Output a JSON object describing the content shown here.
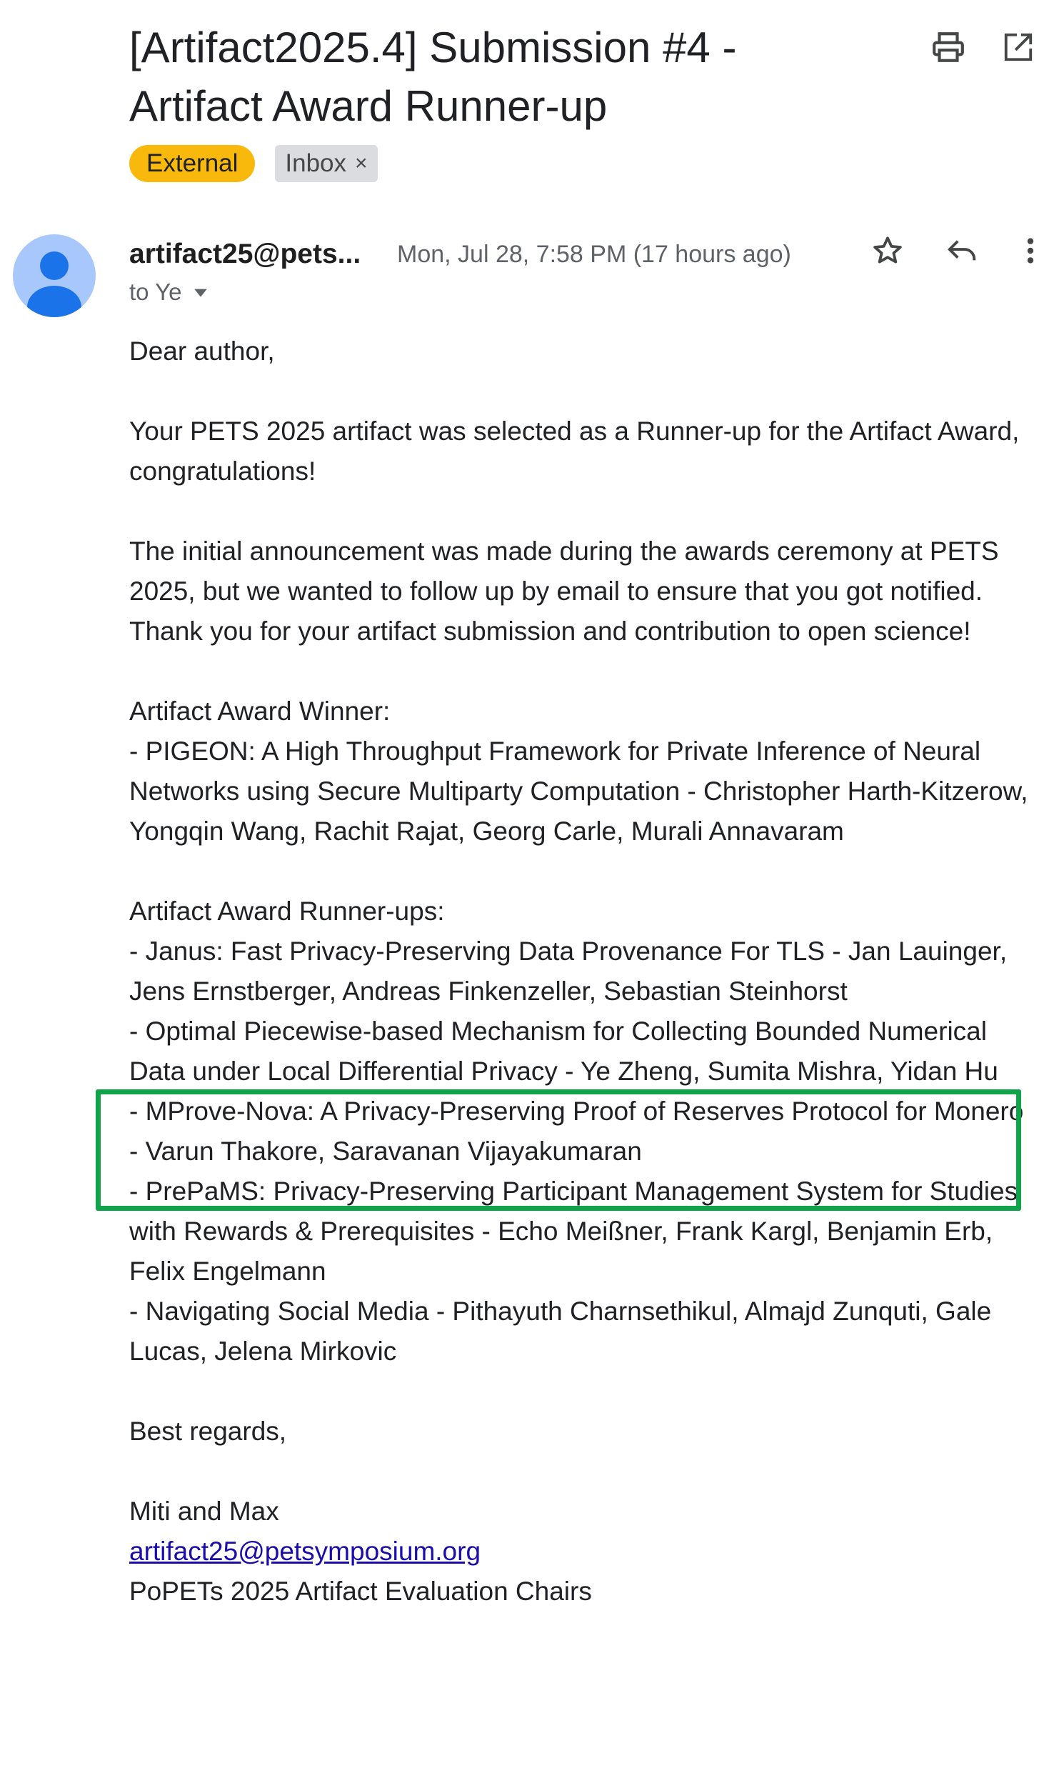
{
  "email": {
    "subject": "[Artifact2025.4] Submission #4 - Artifact Award Runner-up",
    "labels": {
      "external": "External",
      "inbox": "Inbox",
      "inbox_remove": "×"
    },
    "sender": "artifact25@pets...",
    "date": "Mon, Jul 28, 7:58 PM (17 hours ago)",
    "to": "to Ye",
    "body": {
      "greeting": "Dear author,",
      "para1": "Your PETS 2025 artifact was selected as a Runner-up for the Artifact Award, congratulations!",
      "para2a": "The initial announcement was made during the awards ceremony at PETS 2025, but we wanted to follow up by email to ensure that you got notified.",
      "para2b": "Thank you for your artifact submission and contribution to open science!",
      "winner_heading": "Artifact Award Winner:",
      "winner": "- PIGEON: A High Throughput Framework for Private Inference of Neural Networks using Secure Multiparty Computation - Christopher Harth-Kitzerow, Yongqin Wang, Rachit Rajat, Georg Carle, Murali Annavaram",
      "runnerups_heading": "Artifact Award Runner-ups:",
      "runnerups": [
        "- Janus: Fast Privacy-Preserving Data Provenance For TLS - Jan Lauinger, Jens Ernstberger, Andreas Finkenzeller, Sebastian Steinhorst",
        "- Optimal Piecewise-based Mechanism for Collecting Bounded Numerical Data under Local Differential Privacy - Ye Zheng, Sumita Mishra, Yidan Hu",
        "- MProve-Nova: A Privacy-Preserving Proof of Reserves Protocol for Monero - Varun Thakore, Saravanan Vijayakumaran",
        "- PrePaMS: Privacy-Preserving Participant Management System for Studies with Rewards & Prerequisites - Echo Meißner, Frank Kargl, Benjamin Erb, Felix Engelmann",
        "- Navigating Social Media - Pithayuth Charnsethikul, Almajd Zunquti, Gale Lucas, Jelena Mirkovic"
      ],
      "closing": "Best regards,",
      "signature_name": "Miti and Max",
      "signature_email": "artifact25@petsymposium.org",
      "signature_title": "PoPETs 2025 Artifact Evaluation Chairs"
    }
  },
  "icons": [
    "print-icon",
    "open-in-new-window-icon",
    "avatar-person-icon",
    "star-icon",
    "reply-icon",
    "more-vert-icon",
    "dropdown-arrow-icon"
  ],
  "colors": {
    "external_chip": "#f9b90c",
    "inbox_chip": "#dadce0",
    "avatar_bg": "#a8c7fa",
    "avatar_fg": "#1a73e8",
    "highlight_border": "#0fa34a",
    "link": "#1a0dab"
  }
}
